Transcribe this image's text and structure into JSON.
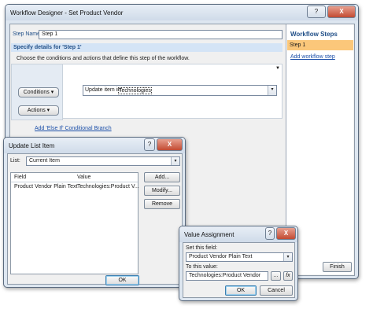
{
  "designer": {
    "title": "Workflow Designer - Set Product Vendor",
    "help_btn": "?",
    "close_btn": "X",
    "step_name_label": "Step Name:",
    "step_name_value": "Step 1",
    "specify_heading": "Specify details for 'Step 1'",
    "choose_text": "Choose the conditions and actions that define this step of the workflow.",
    "conditions_btn": "Conditions ▾",
    "actions_btn": "Actions ▾",
    "action_text": "Update item in",
    "action_link": "Technologies",
    "add_branch_link": "Add 'Else If' Conditional Branch",
    "steps_heading": "Workflow Steps",
    "steps": [
      "Step 1"
    ],
    "add_step_link": "Add workflow step",
    "finish_btn": "Finish"
  },
  "update_dialog": {
    "title": "Update List Item",
    "help_btn": "?",
    "close_btn": "X",
    "list_label": "List:",
    "list_value": "Current Item",
    "columns": [
      "Field",
      "Value"
    ],
    "rows": [
      [
        "Product Vendor Plain Text",
        "Technologies:Product V..."
      ]
    ],
    "add_btn": "Add...",
    "modify_btn": "Modify...",
    "remove_btn": "Remove",
    "ok_btn": "OK"
  },
  "value_dialog": {
    "title": "Value Assignment",
    "help_btn": "?",
    "close_btn": "X",
    "set_field_label": "Set this field:",
    "set_field_value": "Product Vendor Plain Text",
    "to_value_label": "To this value:",
    "to_value_value": "Technologies:Product Vendor",
    "ellipsis_btn": "...",
    "fx_btn": "fx",
    "ok_btn": "OK",
    "cancel_btn": "Cancel"
  },
  "colors": {
    "accent": "#1f4e87",
    "selected_step": "#fbc77a",
    "close_button": "#c24a32",
    "link": "#1a4ea8"
  }
}
